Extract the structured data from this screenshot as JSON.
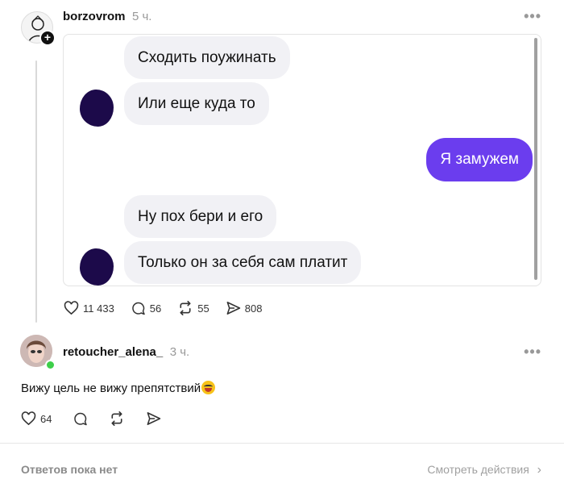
{
  "post": {
    "username": "borzovrom",
    "time": "5 ч.",
    "more_icon": "•••",
    "follow_badge": "+",
    "chat": {
      "messages": [
        {
          "side": "in",
          "text": "Сходить поужинать"
        },
        {
          "side": "in",
          "text": "Или еще куда то"
        },
        {
          "side": "out",
          "text": "Я замужем"
        },
        {
          "side": "in",
          "text": "Ну пох бери и его"
        },
        {
          "side": "in",
          "text": "Только он за себя сам платит"
        }
      ],
      "outgoing_color": "#6b3dee",
      "incoming_color": "#f1f1f5"
    },
    "actions": {
      "likes": "11 433",
      "comments": "56",
      "reposts": "55",
      "shares": "808"
    }
  },
  "reply": {
    "username": "retoucher_alena_",
    "time": "3 ч.",
    "more_icon": "•••",
    "text": "Вижу цель не вижу препятствий",
    "emoji": "grinning-face-emoji",
    "likes": "64"
  },
  "footer": {
    "no_replies": "Ответов пока нет",
    "view_activity": "Смотреть действия",
    "chevron": "›"
  }
}
